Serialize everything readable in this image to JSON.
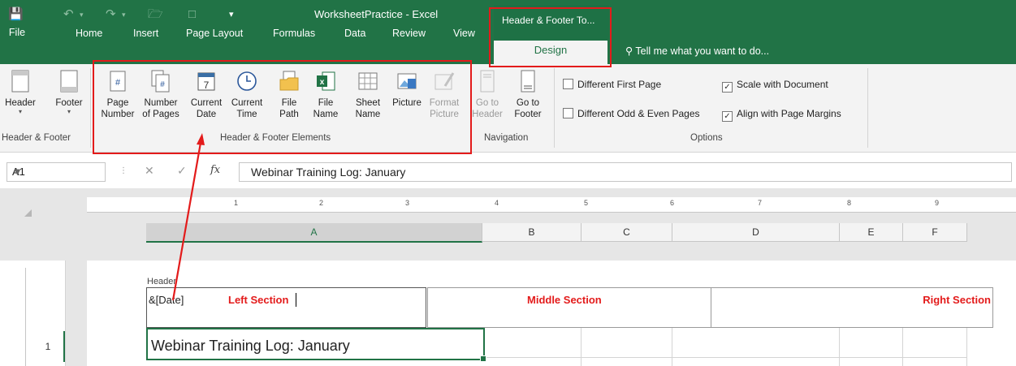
{
  "window": {
    "app_title": "WorksheetPractice - Excel",
    "contextual_tab_group": "Header & Footer To..."
  },
  "tabs": {
    "file": "File",
    "home": "Home",
    "insert": "Insert",
    "page_layout": "Page Layout",
    "formulas": "Formulas",
    "data": "Data",
    "review": "Review",
    "view": "View",
    "design": "Design"
  },
  "tell_me": "Tell me what you want to do...",
  "ribbon": {
    "header_footer_group": {
      "label": "Header & Footer",
      "header": "Header",
      "footer": "Footer"
    },
    "elements_group": {
      "label": "Header & Footer Elements",
      "page_number": [
        "Page",
        "Number"
      ],
      "number_of_pages": [
        "Number",
        "of Pages"
      ],
      "current_date": [
        "Current",
        "Date"
      ],
      "current_time": [
        "Current",
        "Time"
      ],
      "file_path": [
        "File",
        "Path"
      ],
      "file_name": [
        "File",
        "Name"
      ],
      "sheet_name": [
        "Sheet",
        "Name"
      ],
      "picture": [
        "Picture",
        ""
      ],
      "format_picture": [
        "Format",
        "Picture"
      ]
    },
    "navigation_group": {
      "label": "Navigation",
      "go_to_header": [
        "Go to",
        "Header"
      ],
      "go_to_footer": [
        "Go to",
        "Footer"
      ]
    },
    "options_group": {
      "label": "Options",
      "different_first_page": "Different First Page",
      "different_odd_even": "Different Odd & Even Pages",
      "scale_with_document": "Scale with Document",
      "align_with_margins": "Align with Page Margins",
      "different_first_page_checked": false,
      "different_odd_even_checked": false,
      "scale_with_document_checked": true,
      "align_with_margins_checked": true
    }
  },
  "formula_bar": {
    "name_box": "A1",
    "fx": "fx",
    "content": "Webinar Training Log: January"
  },
  "ruler": [
    "1",
    "2",
    "3",
    "4",
    "5",
    "6",
    "7",
    "8",
    "9"
  ],
  "columns": [
    "A",
    "B",
    "C",
    "D",
    "E",
    "F"
  ],
  "header_area": {
    "caption": "Header",
    "left_code": "&[Date]",
    "left_label": "Left Section",
    "middle_label": "Middle Section",
    "right_label": "Right Section"
  },
  "rows": [
    {
      "number": "1",
      "a": "Webinar Training Log: January"
    }
  ],
  "colors": {
    "excel_green": "#217346",
    "annotation_red": "#e31b1b"
  }
}
